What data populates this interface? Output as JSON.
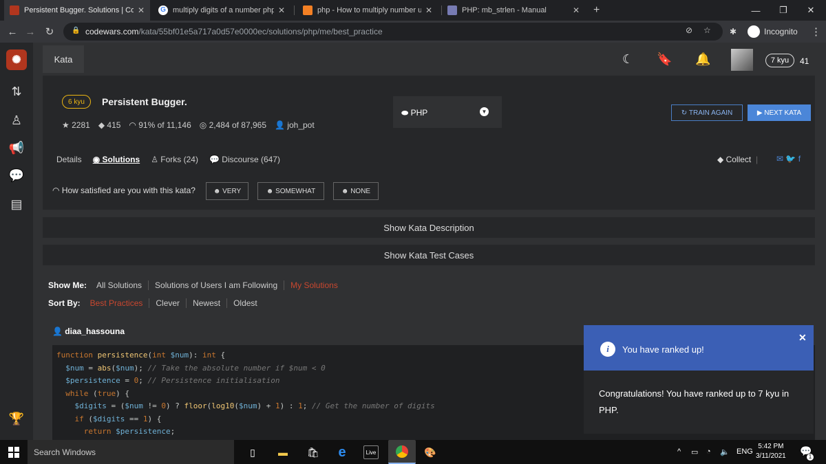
{
  "browser": {
    "tabs": [
      {
        "title": "Persistent Bugger. Solutions | Co",
        "color": "#b1361e"
      },
      {
        "title": "multiply digits of a number php -",
        "color": "#4285f4"
      },
      {
        "title": "php - How to multiply number u",
        "color": "#f48024"
      },
      {
        "title": "PHP: mb_strlen - Manual",
        "color": "#777bb3"
      }
    ],
    "url_host": "codewars.com",
    "url_path": "/kata/55bf01e5a717a0d57e0000ec/solutions/php/me/best_practice",
    "incognito_label": "Incognito"
  },
  "nav": {
    "kata_label": "Kata",
    "rank_badge": "7 kyu",
    "honor": "41"
  },
  "kata": {
    "kyu": "6 kyu",
    "title": "Persistent Bugger.",
    "stars": "2281",
    "votes": "415",
    "satisfaction": "91% of 11,146",
    "completed": "2,484 of 87,965",
    "author": "joh_pot",
    "language": "PHP",
    "train_again": "TRAIN AGAIN",
    "next_kata": "NEXT KATA"
  },
  "tabs": {
    "details": "Details",
    "solutions": "Solutions",
    "forks": "Forks (24)",
    "discourse": "Discourse (647)",
    "collect": "Collect"
  },
  "feedback": {
    "question": "How satisfied are you with this kata?",
    "very": "VERY",
    "somewhat": "SOMEWHAT",
    "none": "NONE"
  },
  "expanders": {
    "description": "Show Kata Description",
    "tests": "Show Kata Test Cases"
  },
  "filters": {
    "show_me_label": "Show Me:",
    "show_me": [
      "All Solutions",
      "Solutions of Users I am Following",
      "My Solutions"
    ],
    "sort_by_label": "Sort By:",
    "sort_by": [
      "Best Practices",
      "Clever",
      "Newest",
      "Oldest"
    ]
  },
  "solution": {
    "user": "diaa_hassouna"
  },
  "toast": {
    "title": "You have ranked up!",
    "body": "Congratulations! You have ranked up to 7 kyu in PHP."
  },
  "taskbar": {
    "search_placeholder": "Search Windows",
    "lang": "ENG",
    "time": "5:42 PM",
    "date": "3/11/2021",
    "notif_count": "1"
  }
}
